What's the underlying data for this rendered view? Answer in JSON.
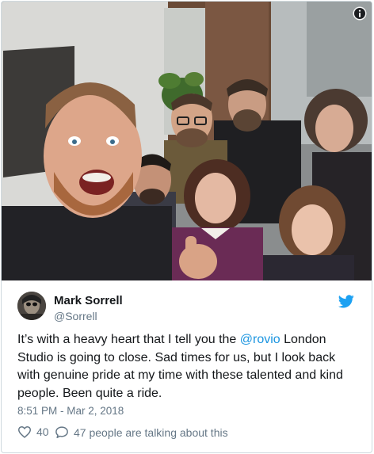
{
  "tweet": {
    "author": {
      "name": "Mark Sorrell",
      "handle": "@Sorrell"
    },
    "text_before": "It’s with a heavy heart that I tell you the ",
    "mention": "@rovio",
    "text_after": " London Studio is going to close. Sad times for us, but I look back with genuine pride at my time with these talented and kind people. Been quite a ride.",
    "timestamp": "8:51 PM - Mar 2, 2018",
    "likes": "40",
    "conversation": "47 people are talking about this"
  },
  "icons": {
    "info": "info-icon",
    "brand": "twitter-bird-icon",
    "like": "heart-icon",
    "reply": "speech-bubble-icon"
  },
  "colors": {
    "link": "#1b95e0",
    "text": "#14171a",
    "secondary": "#657786",
    "border": "#cfd9de"
  }
}
